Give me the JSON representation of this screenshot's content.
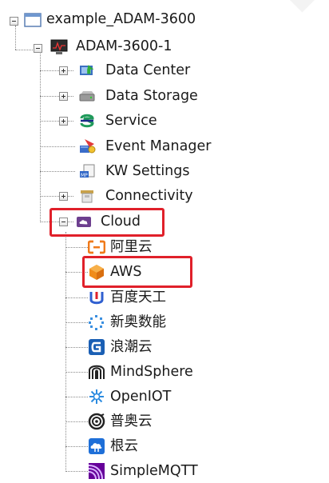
{
  "tree": {
    "root": {
      "label": "example_ADAM-3600",
      "icon": "window-icon"
    },
    "device": {
      "label": "ADAM-3600-1",
      "icon": "device-monitor-icon"
    },
    "children": [
      {
        "label": "Data Center",
        "icon": "data-center-icon",
        "expandable": true
      },
      {
        "label": "Data Storage",
        "icon": "hard-drive-icon",
        "expandable": true
      },
      {
        "label": "Service",
        "icon": "service-icon",
        "expandable": true
      },
      {
        "label": "Event Manager",
        "icon": "event-manager-icon",
        "expandable": false
      },
      {
        "label": "KW Settings",
        "icon": "kw-settings-icon",
        "expandable": false
      },
      {
        "label": "Connectivity",
        "icon": "connectivity-icon",
        "expandable": true
      },
      {
        "label": "Cloud",
        "icon": "cloud-folder-icon",
        "expandable": true,
        "expanded": true,
        "highlighted": true
      }
    ],
    "cloud_items": [
      {
        "label": "阿里云",
        "icon": "aliyun-icon"
      },
      {
        "label": "AWS",
        "icon": "aws-cube-icon",
        "highlighted": true
      },
      {
        "label": "百度天工",
        "icon": "baidu-tiangong-icon"
      },
      {
        "label": "新奥数能",
        "icon": "enn-icon"
      },
      {
        "label": "浪潮云",
        "icon": "inspur-icon"
      },
      {
        "label": "MindSphere",
        "icon": "mindsphere-icon"
      },
      {
        "label": "OpenIOT",
        "icon": "openiot-icon"
      },
      {
        "label": "普奥云",
        "icon": "puaoyun-icon"
      },
      {
        "label": "根云",
        "icon": "rootcloud-icon"
      },
      {
        "label": "SimpleMQTT",
        "icon": "simplemqtt-icon"
      }
    ]
  },
  "colors": {
    "highlight": "#e0202a",
    "aws_orange": "#f08c1a"
  }
}
